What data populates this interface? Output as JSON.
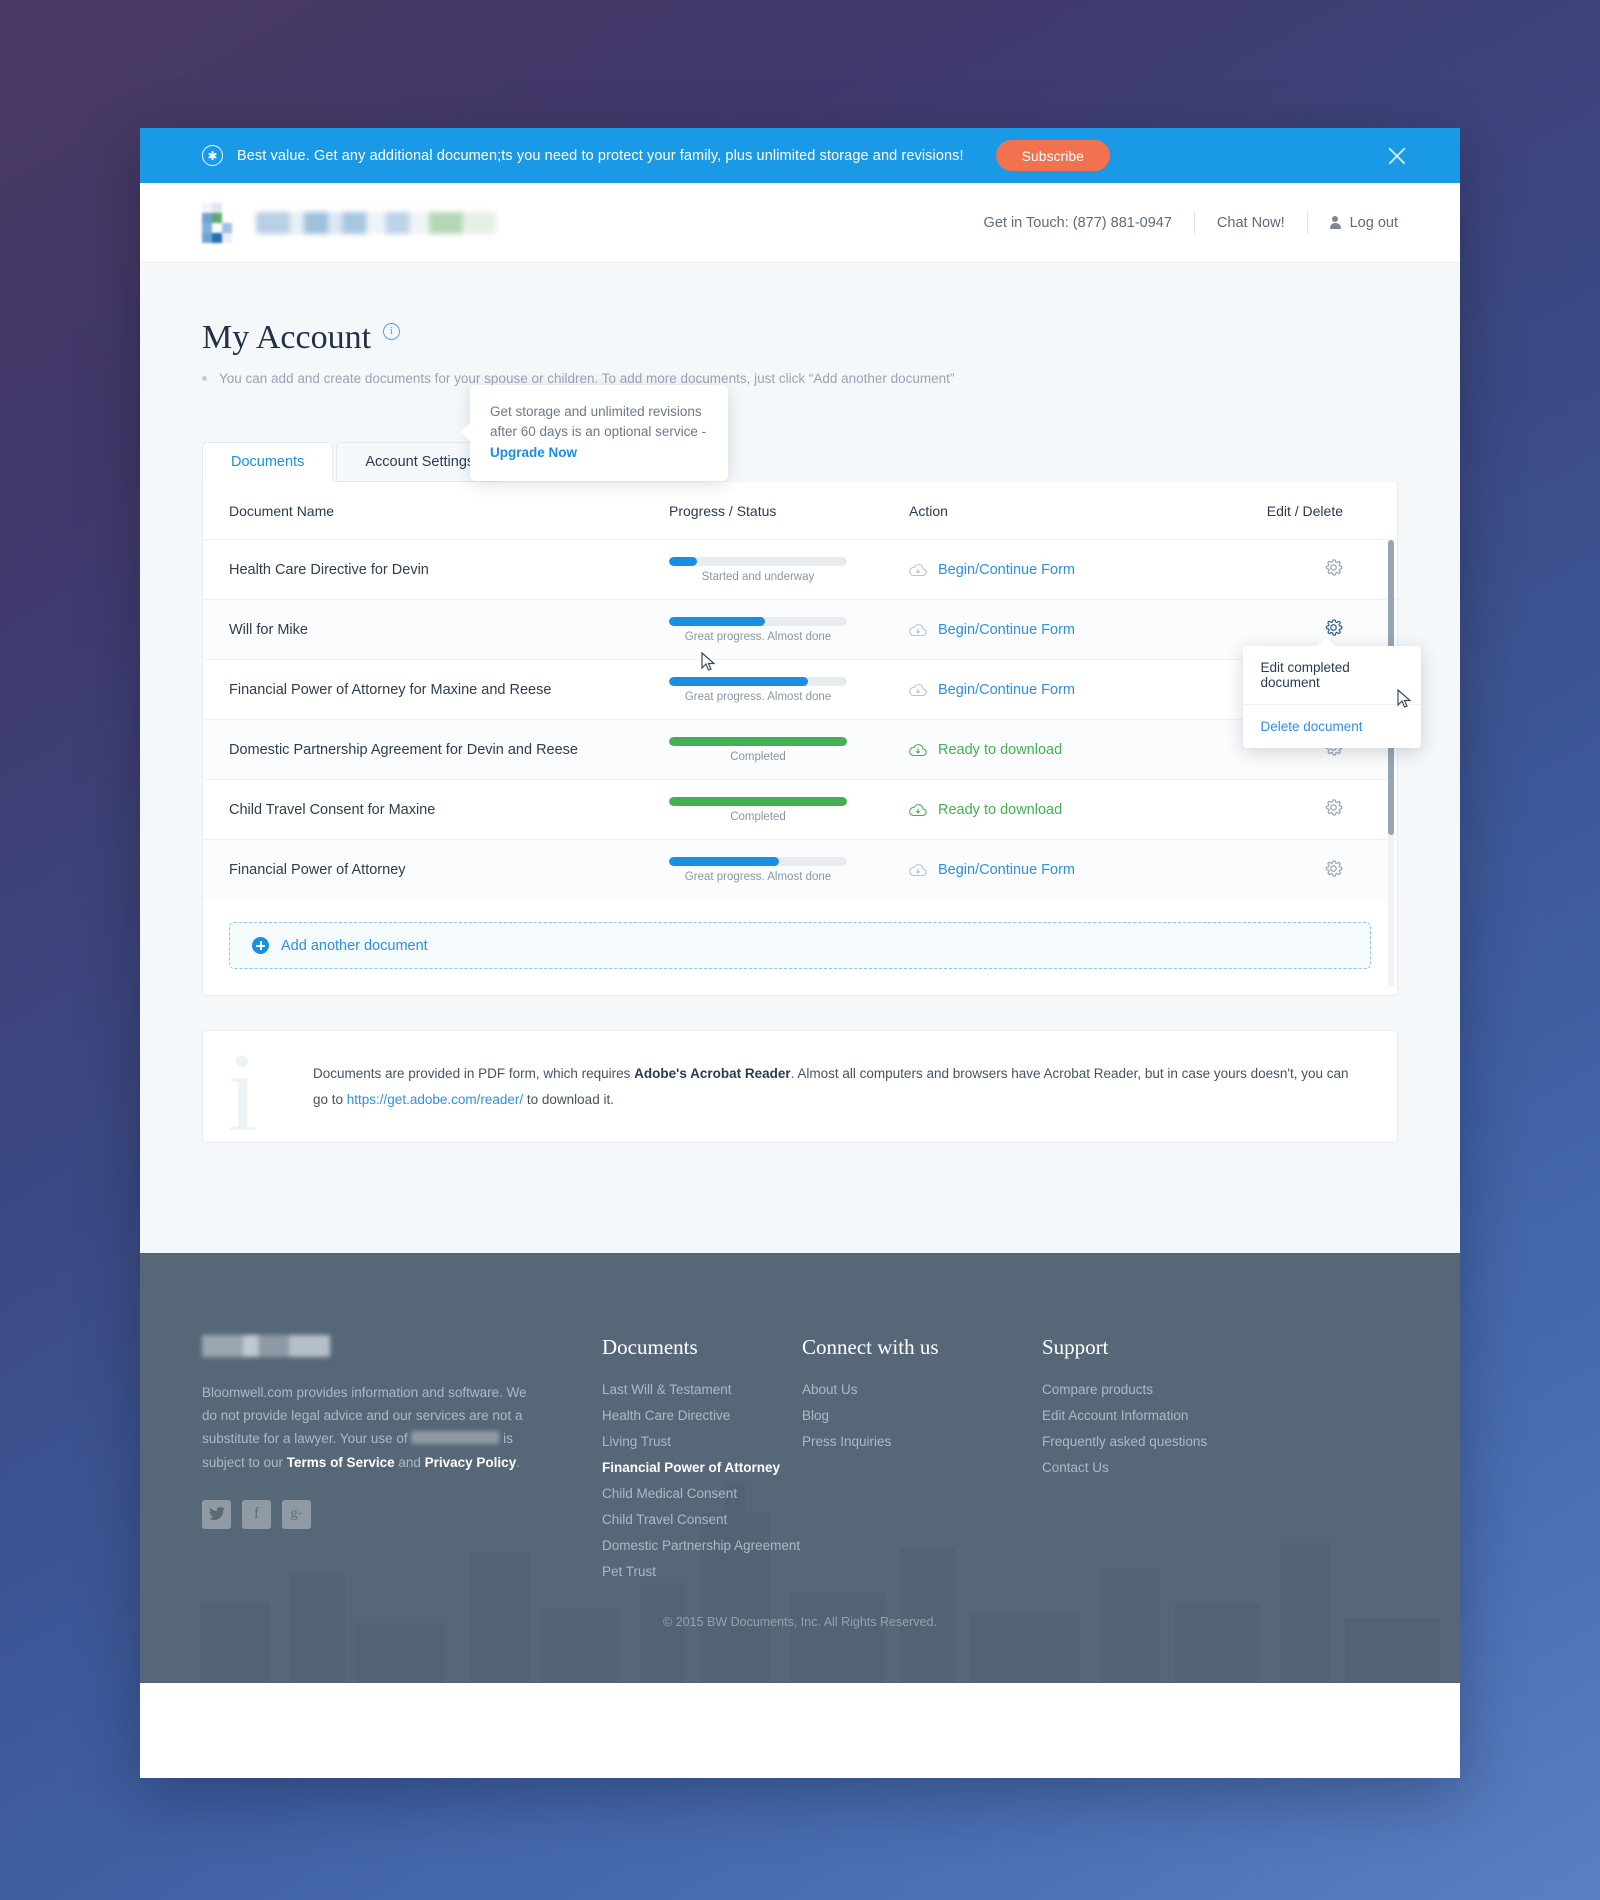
{
  "promo": {
    "icon": "star-badge-icon",
    "text": "Best value. Get any additional documen;ts you need to protect your family, plus unlimited storage and revisions!",
    "button_label": "Subscribe",
    "close_icon": "close-icon",
    "bg_color": "#1a9ae6",
    "button_color": "#f2714e"
  },
  "header": {
    "contact_label": "Get in Touch: (877) 881-0947",
    "chat_label": "Chat Now!",
    "logout_label": "Log out"
  },
  "page": {
    "title": "My Account",
    "note": "You can add and create documents for your spouse or children. To add more documents, just click “Add another document”",
    "tooltip": {
      "text": "Get storage and unlimited revisions after 60 days is an optional service - ",
      "link": "Upgrade Now"
    }
  },
  "tabs": [
    {
      "label": "Documents",
      "active": true
    },
    {
      "label": "Account Settings",
      "active": false
    }
  ],
  "table": {
    "headers": {
      "name": "Document Name",
      "progress": "Progress / Status",
      "action": "Action",
      "edit": "Edit / Delete"
    },
    "rows": [
      {
        "name": "Health Care Directive for Devin",
        "progress_pct": 16,
        "progress_color": "#1a8fe0",
        "status": "Started and underway",
        "action": "Begin/Continue Form",
        "action_type": "form"
      },
      {
        "name": "Will for Mike",
        "progress_pct": 54,
        "progress_color": "#1a8fe0",
        "status": "Great progress. Almost done",
        "action": "Begin/Continue Form",
        "action_type": "form"
      },
      {
        "name": "Financial Power of Attorney for Maxine and Reese",
        "progress_pct": 78,
        "progress_color": "#1a8fe0",
        "status": "Great progress. Almost done",
        "action": "Begin/Continue Form",
        "action_type": "form"
      },
      {
        "name": "Domestic Partnership Agreement for Devin and Reese",
        "progress_pct": 100,
        "progress_color": "#45b053",
        "status": "Completed",
        "action": "Ready to download",
        "action_type": "download"
      },
      {
        "name": "Child Travel Consent for Maxine",
        "progress_pct": 100,
        "progress_color": "#45b053",
        "status": "Completed",
        "action": "Ready to download",
        "action_type": "download"
      },
      {
        "name": "Financial Power of Attorney",
        "progress_pct": 62,
        "progress_color": "#1a8fe0",
        "status": "Great progress. Almost done",
        "action": "Begin/Continue Form",
        "action_type": "form"
      }
    ],
    "add_label": "Add another document"
  },
  "context_menu": {
    "items": [
      "Edit completed document",
      "Delete document"
    ]
  },
  "pdf_note": {
    "part1": "Documents are provided in PDF form, which requires ",
    "bold": "Adobe's Acrobat Reader",
    "part2": ". Almost all computers and browsers have Acrobat Reader, but in case yours doesn't, you can go to ",
    "link": "https://get.adobe.com/reader/",
    "part3": " to download it."
  },
  "footer": {
    "about": {
      "line1": "Bloomwell.com provides information and software. We do not provide legal advice and our services are not a substitute for a lawyer. Your use of ",
      "mid": " is subject to our ",
      "tos": "Terms of Service",
      "and": " and ",
      "privacy": "Privacy Policy",
      "end": "."
    },
    "socials": [
      {
        "name": "twitter-icon",
        "glyph": "🐦"
      },
      {
        "name": "facebook-icon",
        "glyph": "f"
      },
      {
        "name": "google-plus-icon",
        "glyph": "g⁺"
      }
    ],
    "columns": [
      {
        "heading": "Documents",
        "links": [
          {
            "label": "Last Will & Testament",
            "active": false
          },
          {
            "label": "Health Care Directive",
            "active": false
          },
          {
            "label": "Living Trust",
            "active": false
          },
          {
            "label": "Financial Power of Attorney",
            "active": true
          },
          {
            "label": "Child Medical Consent",
            "active": false
          },
          {
            "label": "Child Travel Consent",
            "active": false
          },
          {
            "label": "Domestic Partnership Agreement",
            "active": false
          },
          {
            "label": "Pet Trust",
            "active": false
          }
        ]
      },
      {
        "heading": "Connect with us",
        "links": [
          {
            "label": "About Us",
            "active": false
          },
          {
            "label": "Blog",
            "active": false
          },
          {
            "label": "Press Inquiries",
            "active": false
          }
        ]
      },
      {
        "heading": "Support",
        "links": [
          {
            "label": "Compare products",
            "active": false
          },
          {
            "label": "Edit Account Information",
            "active": false
          },
          {
            "label": "Frequently asked questions",
            "active": false
          },
          {
            "label": "Contact Us",
            "active": false
          }
        ]
      }
    ],
    "copyright": "© 2015 BW Documents, Inc. All Rights Reserved."
  }
}
